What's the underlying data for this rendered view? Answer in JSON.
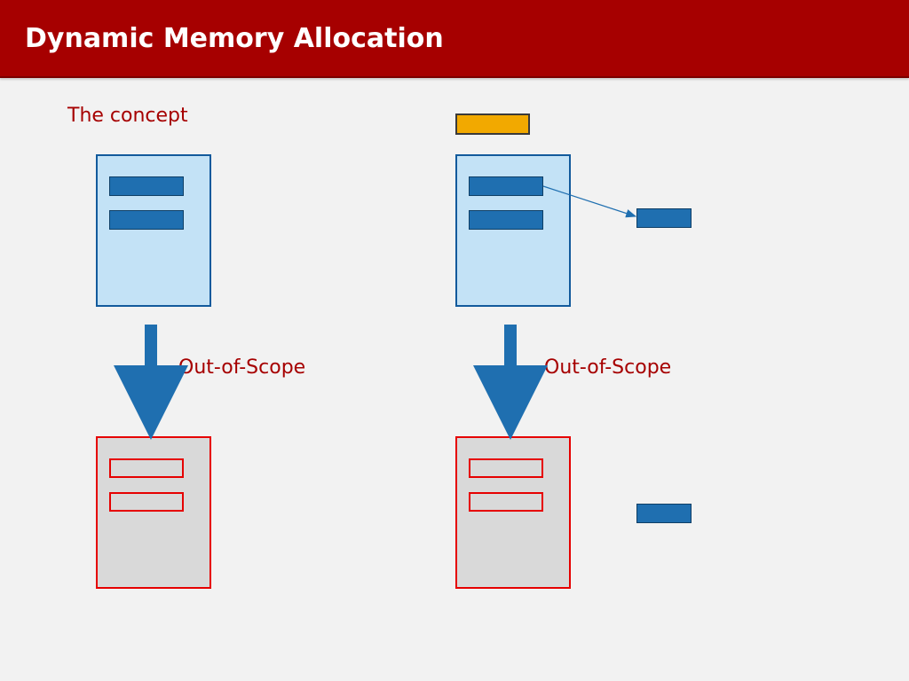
{
  "header": {
    "title": "Dynamic Memory Allocation"
  },
  "labels": {
    "concept": "The concept",
    "out_of_scope_left": "Out-of-Scope",
    "out_of_scope_right": "Out-of-Scope"
  }
}
